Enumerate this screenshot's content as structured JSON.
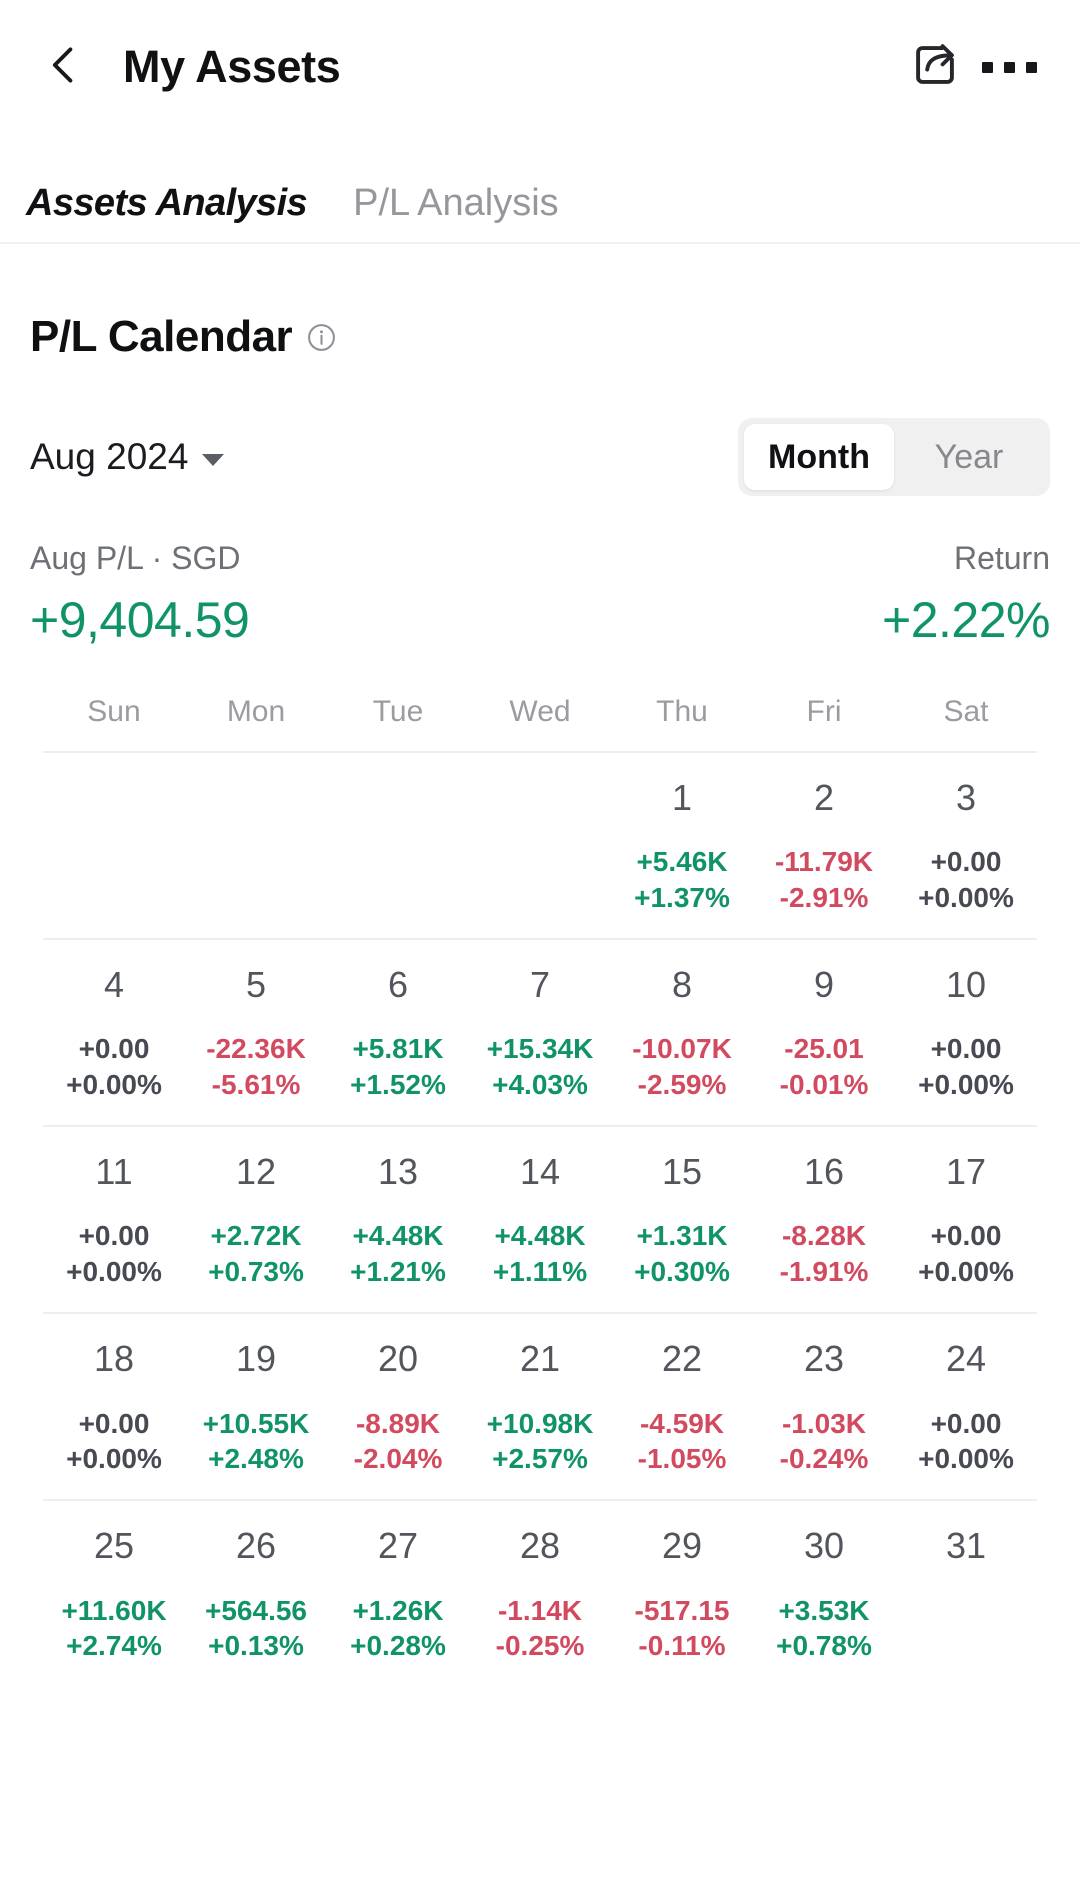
{
  "navbar": {
    "back_icon": "chevron-left-icon",
    "title": "My Assets",
    "share_icon": "share-icon",
    "more_icon": "more-options-icon"
  },
  "tabs": [
    {
      "label": "Assets Analysis",
      "active": true
    },
    {
      "label": "P/L Analysis",
      "active": false
    }
  ],
  "section": {
    "title": "P/L Calendar",
    "info_icon": "info-icon"
  },
  "controls": {
    "month_label": "Aug 2024",
    "caret_icon": "chevron-down-icon",
    "range_options": [
      {
        "label": "Month",
        "active": true
      },
      {
        "label": "Year",
        "active": false
      }
    ]
  },
  "summary": {
    "pl_label": "Aug P/L · SGD",
    "pl_value": "+9,404.59",
    "pl_state": "pos",
    "return_label": "Return",
    "return_value": "+2.22%",
    "return_state": "pos"
  },
  "colors": {
    "positive": "#11936a",
    "negative": "#d24a5f",
    "zero": "#474a52",
    "accent": "#ed6a1b"
  },
  "calendar": {
    "weekday_headers": [
      "Sun",
      "Mon",
      "Tue",
      "Wed",
      "Thu",
      "Fri",
      "Sat"
    ],
    "weeks": [
      [
        {
          "day": "",
          "amount": "",
          "percent": "",
          "state": ""
        },
        {
          "day": "",
          "amount": "",
          "percent": "",
          "state": ""
        },
        {
          "day": "",
          "amount": "",
          "percent": "",
          "state": ""
        },
        {
          "day": "",
          "amount": "",
          "percent": "",
          "state": ""
        },
        {
          "day": "1",
          "amount": "+5.46K",
          "percent": "+1.37%",
          "state": "pos"
        },
        {
          "day": "2",
          "amount": "-11.79K",
          "percent": "-2.91%",
          "state": "neg"
        },
        {
          "day": "3",
          "amount": "+0.00",
          "percent": "+0.00%",
          "state": "zero"
        }
      ],
      [
        {
          "day": "4",
          "amount": "+0.00",
          "percent": "+0.00%",
          "state": "zero"
        },
        {
          "day": "5",
          "amount": "-22.36K",
          "percent": "-5.61%",
          "state": "neg"
        },
        {
          "day": "6",
          "amount": "+5.81K",
          "percent": "+1.52%",
          "state": "pos"
        },
        {
          "day": "7",
          "amount": "+15.34K",
          "percent": "+4.03%",
          "state": "pos"
        },
        {
          "day": "8",
          "amount": "-10.07K",
          "percent": "-2.59%",
          "state": "neg"
        },
        {
          "day": "9",
          "amount": "-25.01",
          "percent": "-0.01%",
          "state": "neg"
        },
        {
          "day": "10",
          "amount": "+0.00",
          "percent": "+0.00%",
          "state": "zero"
        }
      ],
      [
        {
          "day": "11",
          "amount": "+0.00",
          "percent": "+0.00%",
          "state": "zero"
        },
        {
          "day": "12",
          "amount": "+2.72K",
          "percent": "+0.73%",
          "state": "pos"
        },
        {
          "day": "13",
          "amount": "+4.48K",
          "percent": "+1.21%",
          "state": "pos"
        },
        {
          "day": "14",
          "amount": "+4.48K",
          "percent": "+1.11%",
          "state": "pos"
        },
        {
          "day": "15",
          "amount": "+1.31K",
          "percent": "+0.30%",
          "state": "pos"
        },
        {
          "day": "16",
          "amount": "-8.28K",
          "percent": "-1.91%",
          "state": "neg"
        },
        {
          "day": "17",
          "amount": "+0.00",
          "percent": "+0.00%",
          "state": "zero"
        }
      ],
      [
        {
          "day": "18",
          "amount": "+0.00",
          "percent": "+0.00%",
          "state": "zero"
        },
        {
          "day": "19",
          "amount": "+10.55K",
          "percent": "+2.48%",
          "state": "pos"
        },
        {
          "day": "20",
          "amount": "-8.89K",
          "percent": "-2.04%",
          "state": "neg"
        },
        {
          "day": "21",
          "amount": "+10.98K",
          "percent": "+2.57%",
          "state": "pos"
        },
        {
          "day": "22",
          "amount": "-4.59K",
          "percent": "-1.05%",
          "state": "neg"
        },
        {
          "day": "23",
          "amount": "-1.03K",
          "percent": "-0.24%",
          "state": "neg"
        },
        {
          "day": "24",
          "amount": "+0.00",
          "percent": "+0.00%",
          "state": "zero"
        }
      ],
      [
        {
          "day": "25",
          "amount": "+11.60K",
          "percent": "+2.74%",
          "state": "pos"
        },
        {
          "day": "26",
          "amount": "+564.56",
          "percent": "+0.13%",
          "state": "pos"
        },
        {
          "day": "27",
          "amount": "+1.26K",
          "percent": "+0.28%",
          "state": "pos"
        },
        {
          "day": "28",
          "amount": "-1.14K",
          "percent": "-0.25%",
          "state": "neg"
        },
        {
          "day": "29",
          "amount": "-517.15",
          "percent": "-0.11%",
          "state": "neg"
        },
        {
          "day": "30",
          "amount": "+3.53K",
          "percent": "+0.78%",
          "state": "pos"
        },
        {
          "day": "31",
          "amount": "",
          "percent": "",
          "state": ""
        }
      ]
    ]
  }
}
